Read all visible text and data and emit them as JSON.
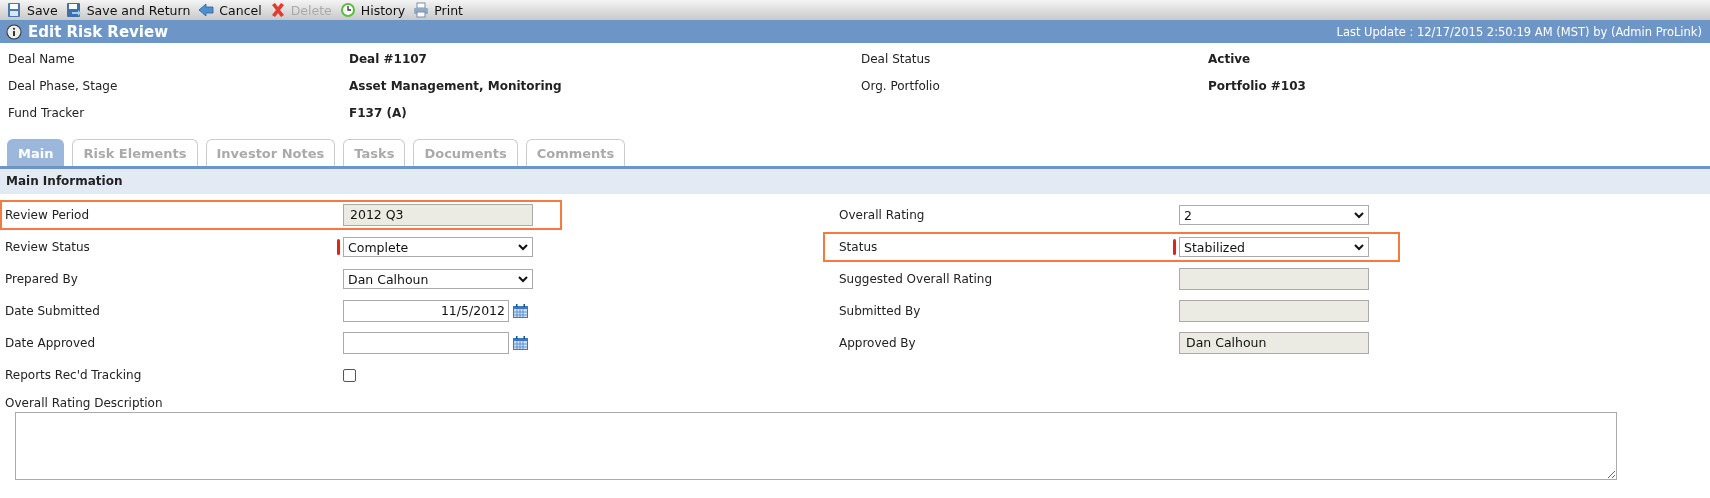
{
  "toolbar": [
    {
      "label": "Save",
      "kind": "save",
      "disabled": false
    },
    {
      "label": "Save and Return",
      "kind": "save-return",
      "disabled": false
    },
    {
      "label": "Cancel",
      "kind": "cancel",
      "disabled": false
    },
    {
      "label": "Delete",
      "kind": "delete",
      "disabled": true
    },
    {
      "label": "History",
      "kind": "history",
      "disabled": false
    },
    {
      "label": "Print",
      "kind": "print",
      "disabled": false
    }
  ],
  "title": "Edit Risk Review",
  "last_update": "Last Update : 12/17/2015 2:50:19 AM (MST) by (Admin ProLink)",
  "header_rows": [
    [
      {
        "label": "Deal Name",
        "value": "Deal #1107"
      },
      {
        "label": "Deal Status",
        "value": "Active"
      }
    ],
    [
      {
        "label": "Deal Phase, Stage",
        "value": "Asset Management, Monitoring"
      },
      {
        "label": "Org. Portfolio",
        "value": "Portfolio #103"
      }
    ],
    [
      {
        "label": "Fund Tracker",
        "value": "F137 (A)"
      }
    ]
  ],
  "tabs": [
    {
      "label": "Main",
      "selected": true
    },
    {
      "label": "Risk Elements",
      "selected": false
    },
    {
      "label": "Investor Notes",
      "selected": false
    },
    {
      "label": "Tasks",
      "selected": false
    },
    {
      "label": "Documents",
      "selected": false
    },
    {
      "label": "Comments",
      "selected": false
    }
  ],
  "section_title": "Main Information",
  "form_rows": [
    [
      {
        "label": "Review Period",
        "kind": "readonly",
        "value": "2012 Q3",
        "required": false,
        "highlighted": true
      },
      {
        "label": "Overall Rating",
        "kind": "select",
        "value": "2",
        "required": false,
        "highlighted": false
      }
    ],
    [
      {
        "label": "Review Status",
        "kind": "select",
        "value": "Complete",
        "required": true,
        "highlighted": false
      },
      {
        "label": "Status",
        "kind": "select",
        "value": "Stabilized",
        "required": true,
        "highlighted": true
      }
    ],
    [
      {
        "label": "Prepared By",
        "kind": "select",
        "value": "Dan Calhoun",
        "required": false,
        "highlighted": false
      },
      {
        "label": "Suggested Overall Rating",
        "kind": "readonly",
        "required": false,
        "highlighted": false
      }
    ],
    [
      {
        "label": "Date Submitted",
        "kind": "date",
        "value": "11/5/2012",
        "required": false,
        "highlighted": false
      },
      {
        "label": "Submitted By",
        "kind": "readonly",
        "required": false,
        "highlighted": false
      }
    ],
    [
      {
        "label": "Date Approved",
        "kind": "date",
        "required": false,
        "highlighted": false
      },
      {
        "label": "Approved By",
        "kind": "readonly",
        "value": "Dan Calhoun",
        "required": false,
        "highlighted": false
      }
    ],
    [
      {
        "label": "Reports Rec'd Tracking",
        "kind": "checkbox",
        "checked": false,
        "required": false,
        "highlighted": false
      }
    ]
  ],
  "description": {
    "label": "Overall Rating Description"
  }
}
